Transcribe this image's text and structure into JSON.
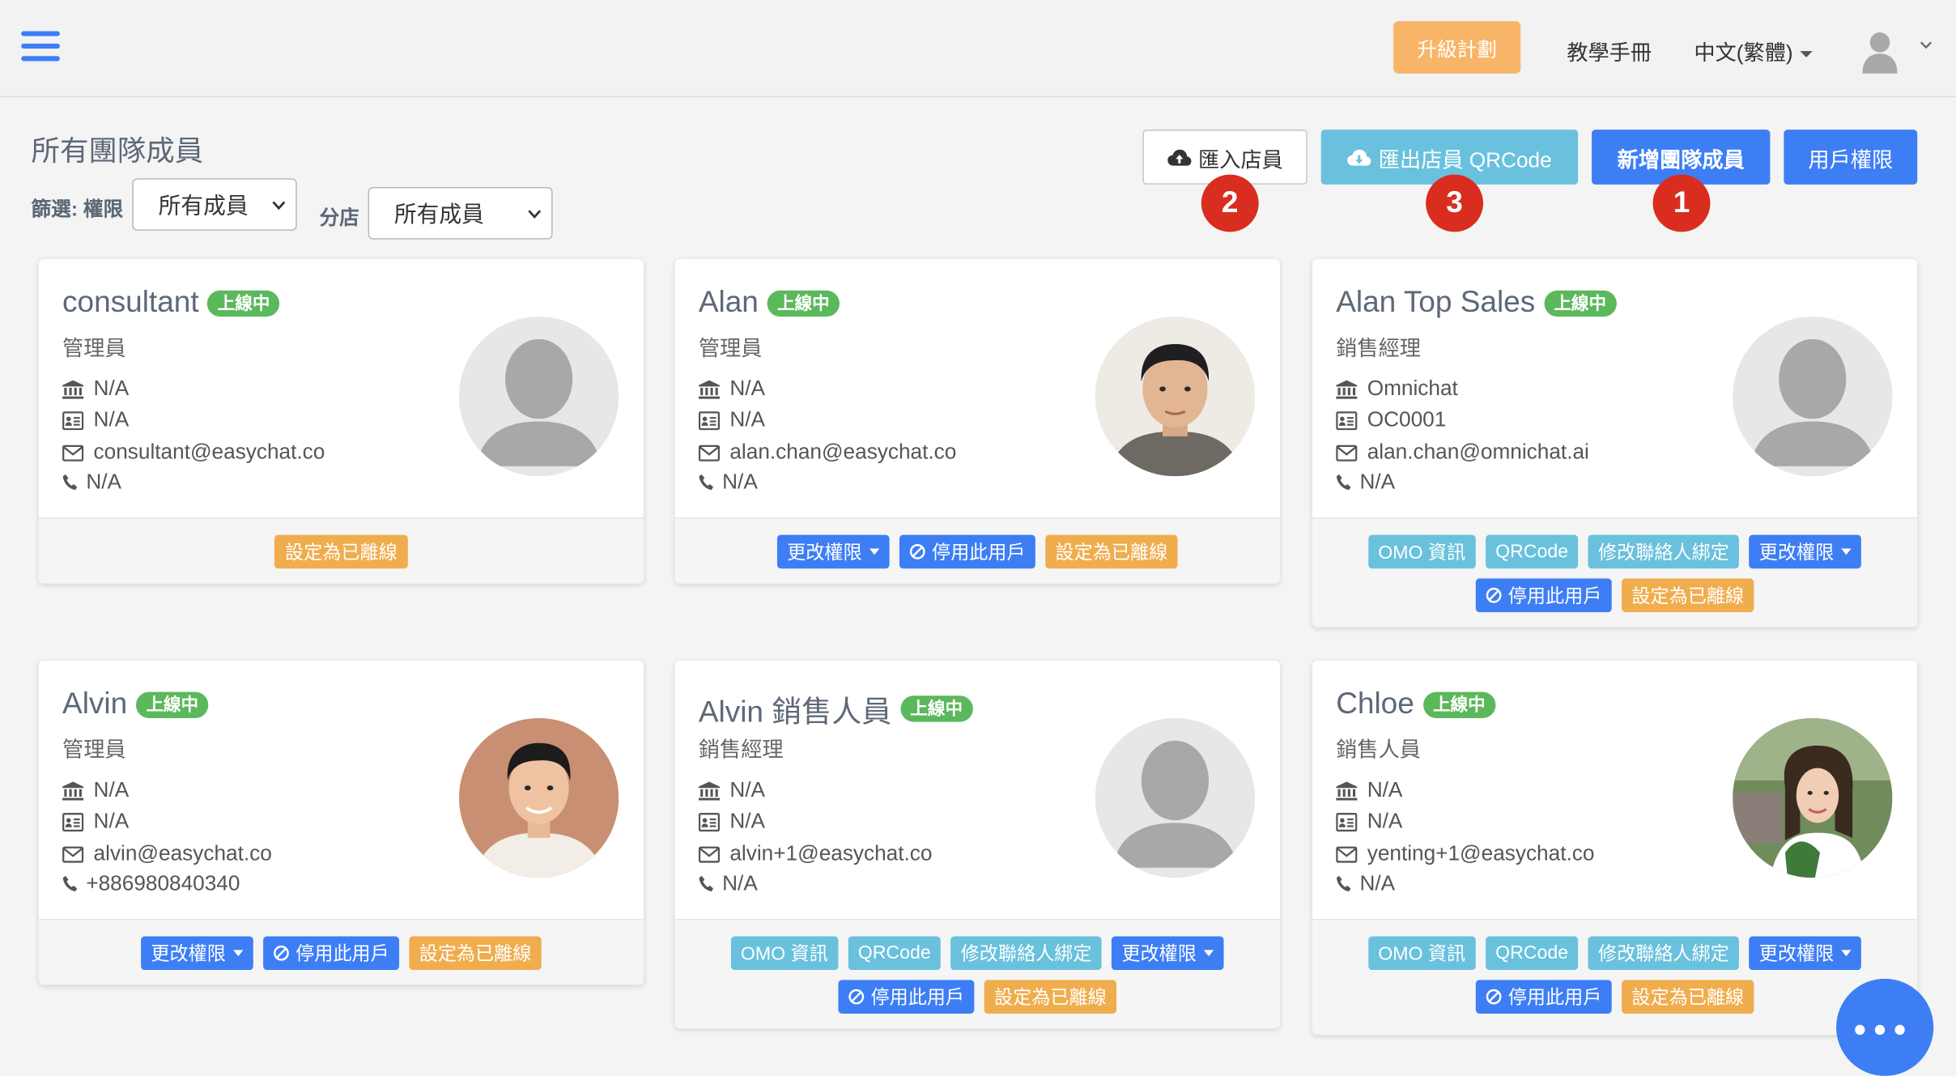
{
  "topbar": {
    "menu_icon": "hamburger-menu-icon",
    "upgrade_label": "升級計劃",
    "tutorial_label": "教學手冊",
    "language_label": "中文(繁體)",
    "profile_icon": "user-avatar-icon"
  },
  "page": {
    "title": "所有團隊成員",
    "filter_label": "篩選: 權限",
    "filter_value": "所有成員",
    "branch_label": "分店",
    "branch_value": "所有成員"
  },
  "actions": {
    "import_label": "匯入店員",
    "export_label": "匯出店員 QRCode",
    "add_label": "新增團隊成員",
    "permissions_label": "用戶權限"
  },
  "markers": [
    "1",
    "2",
    "3"
  ],
  "labels": {
    "status": "上線中",
    "omo": "OMO 資訊",
    "qrcode": "QRCode",
    "bind": "修改聯絡人綁定",
    "change_perm": "更改權限",
    "deactivate": "停用此用戶",
    "set_offline": "設定為已離線"
  },
  "members": [
    {
      "name": "consultant",
      "role": "管理員",
      "branch": "N/A",
      "id": "N/A",
      "email": "consultant@easychat.co",
      "phone": "N/A"
    },
    {
      "name": "Alan",
      "role": "管理員",
      "branch": "N/A",
      "id": "N/A",
      "email": "alan.chan@easychat.co",
      "phone": "N/A"
    },
    {
      "name": "Alan Top Sales",
      "role": "銷售經理",
      "branch": "Omnichat",
      "id": "OC0001",
      "email": "alan.chan@omnichat.ai",
      "phone": "N/A"
    },
    {
      "name": "Alvin",
      "role": "管理員",
      "branch": "N/A",
      "id": "N/A",
      "email": "alvin@easychat.co",
      "phone": "+886980840340"
    },
    {
      "name": "Alvin 銷售人員",
      "role": "銷售經理",
      "branch": "N/A",
      "id": "N/A",
      "email": "alvin+1@easychat.co",
      "phone": "N/A"
    },
    {
      "name": "Chloe",
      "role": "銷售人員",
      "branch": "N/A",
      "id": "N/A",
      "email": "yenting+1@easychat.co",
      "phone": "N/A"
    }
  ],
  "colors": {
    "primary": "#3d7ef5",
    "info": "#69c1dd",
    "warning": "#f0ad4e",
    "success": "#5cb85c",
    "upgrade": "#f8b567",
    "marker": "#d92d20"
  }
}
